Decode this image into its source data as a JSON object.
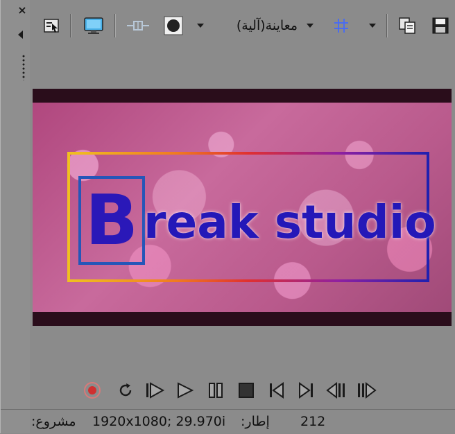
{
  "colors": {
    "panel_bg": "#8b8b8b",
    "record_red": "#d03030",
    "grid_blue": "#4a6cf0",
    "icon_dark": "#1a1a1a"
  },
  "window": {
    "close_icon": "close-icon",
    "pin_icon": "pin-arrow-icon",
    "grip_icon": "grip-dots-icon"
  },
  "toolbar": {
    "preview_quality_label": "معاينة(آلية)",
    "items": [
      {
        "name": "select-icon",
        "role": "tool"
      },
      {
        "name": "monitor-icon",
        "role": "video-output"
      },
      {
        "name": "split-screen-icon",
        "role": "split-screen"
      },
      {
        "name": "overlay-icon",
        "role": "overlays"
      },
      {
        "name": "grid-icon",
        "role": "grid"
      },
      {
        "name": "copy-snapshot-icon",
        "role": "copy-snapshot"
      },
      {
        "name": "save-snapshot-icon",
        "role": "save-snapshot"
      }
    ]
  },
  "video": {
    "logo_letter": "B",
    "logo_text": "reak studio"
  },
  "transport": [
    {
      "name": "record-icon"
    },
    {
      "name": "loop-icon"
    },
    {
      "name": "play-from-start-icon"
    },
    {
      "name": "play-icon"
    },
    {
      "name": "pause-icon"
    },
    {
      "name": "stop-icon"
    },
    {
      "name": "previous-frame-icon"
    },
    {
      "name": "next-frame-icon"
    },
    {
      "name": "step-back-icon"
    },
    {
      "name": "step-forward-icon"
    }
  ],
  "status": {
    "project_label": "مشروع:",
    "project_value": "1920x1080; 29.970i",
    "frame_label": "إطار:",
    "frame_value": "212"
  }
}
